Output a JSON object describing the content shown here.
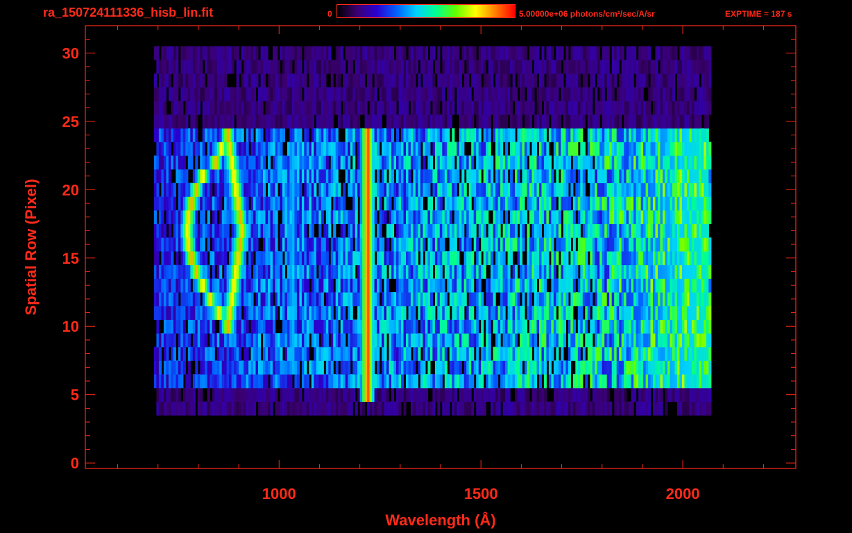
{
  "header": {
    "filename": "ra_150724111336_hisb_lin.fit",
    "colorbar_min_label": "0",
    "colorbar_max_label": "5.00000e+06 photons/cm²/sec/A/sr",
    "exptime_label": "EXPTIME = 187 s"
  },
  "colors": {
    "foreground": "#ff2a1a",
    "background": "#000000",
    "colormap": [
      "#000000",
      "#3a0070",
      "#2a00d0",
      "#0060ff",
      "#00d0ff",
      "#00ff90",
      "#60ff00",
      "#ffff00",
      "#ff8000",
      "#ff0000"
    ]
  },
  "chart_data": {
    "type": "heatmap",
    "xlabel": "Wavelength (Å)",
    "ylabel": "Spatial Row (Pixel)",
    "xlim": [
      520,
      2280
    ],
    "ylim": [
      -0.4,
      32
    ],
    "x_ticks": [
      1000,
      1500,
      2000
    ],
    "y_ticks": [
      0,
      5,
      10,
      15,
      20,
      25,
      30
    ],
    "colorbar_range": [
      0,
      5000000
    ],
    "colorbar_units": "photons/cm²/sec/A/sr",
    "grid": false,
    "data_extent": {
      "x_range": [
        690,
        2070
      ],
      "row_range": [
        4,
        30
      ]
    },
    "features": [
      {
        "name": "arc",
        "x_center": 870,
        "x_half_width": 100,
        "row_range": [
          10,
          24
        ],
        "peak_fraction": 0.85
      },
      {
        "name": "line-1216",
        "x": 1216,
        "row_range": [
          5,
          24
        ],
        "peak_fraction": 1.0
      },
      {
        "name": "line-1025",
        "x": 1030,
        "row_range": [
          7,
          23
        ],
        "peak_fraction": 0.45
      },
      {
        "name": "line-1304",
        "x": 1300,
        "row_range": [
          7,
          23
        ],
        "peak_fraction": 0.35
      },
      {
        "name": "band-1800-2060",
        "x_range": [
          1780,
          2060
        ],
        "row_range": [
          6,
          24
        ],
        "peak_fraction": 0.5
      }
    ]
  }
}
